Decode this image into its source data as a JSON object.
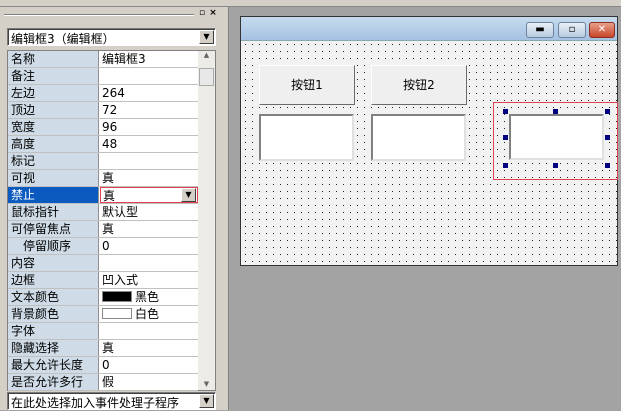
{
  "panel": {
    "object_selector": "编辑框3（编辑框）",
    "event_selector": "在此处选择加入事件处理子程序",
    "properties": [
      {
        "label": "名称",
        "value": "编辑框3"
      },
      {
        "label": "备注",
        "value": ""
      },
      {
        "label": "左边",
        "value": "264"
      },
      {
        "label": "顶边",
        "value": "72"
      },
      {
        "label": "宽度",
        "value": "96"
      },
      {
        "label": "高度",
        "value": "48"
      },
      {
        "label": "标记",
        "value": ""
      },
      {
        "label": "可视",
        "value": "真"
      },
      {
        "label": "禁止",
        "value": "真"
      },
      {
        "label": "鼠标指针",
        "value": "默认型"
      },
      {
        "label": "可停留焦点",
        "value": "真"
      },
      {
        "label": "　停留顺序",
        "value": "0"
      },
      {
        "label": "内容",
        "value": ""
      },
      {
        "label": "边框",
        "value": "凹入式"
      },
      {
        "label": "文本颜色",
        "value": "黑色",
        "swatch": "#000000"
      },
      {
        "label": "背景颜色",
        "value": "白色",
        "swatch": "#ffffff"
      },
      {
        "label": "字体",
        "value": ""
      },
      {
        "label": "隐藏选择",
        "value": "真"
      },
      {
        "label": "最大允许长度",
        "value": "0"
      },
      {
        "label": "是否允许多行",
        "value": "假"
      }
    ]
  },
  "form": {
    "button1": "按钮1",
    "button2": "按钮2"
  },
  "colors": {
    "selected_row": "#0a5abf",
    "label_bg": "#cfdbe6",
    "selection": "#e04050"
  }
}
